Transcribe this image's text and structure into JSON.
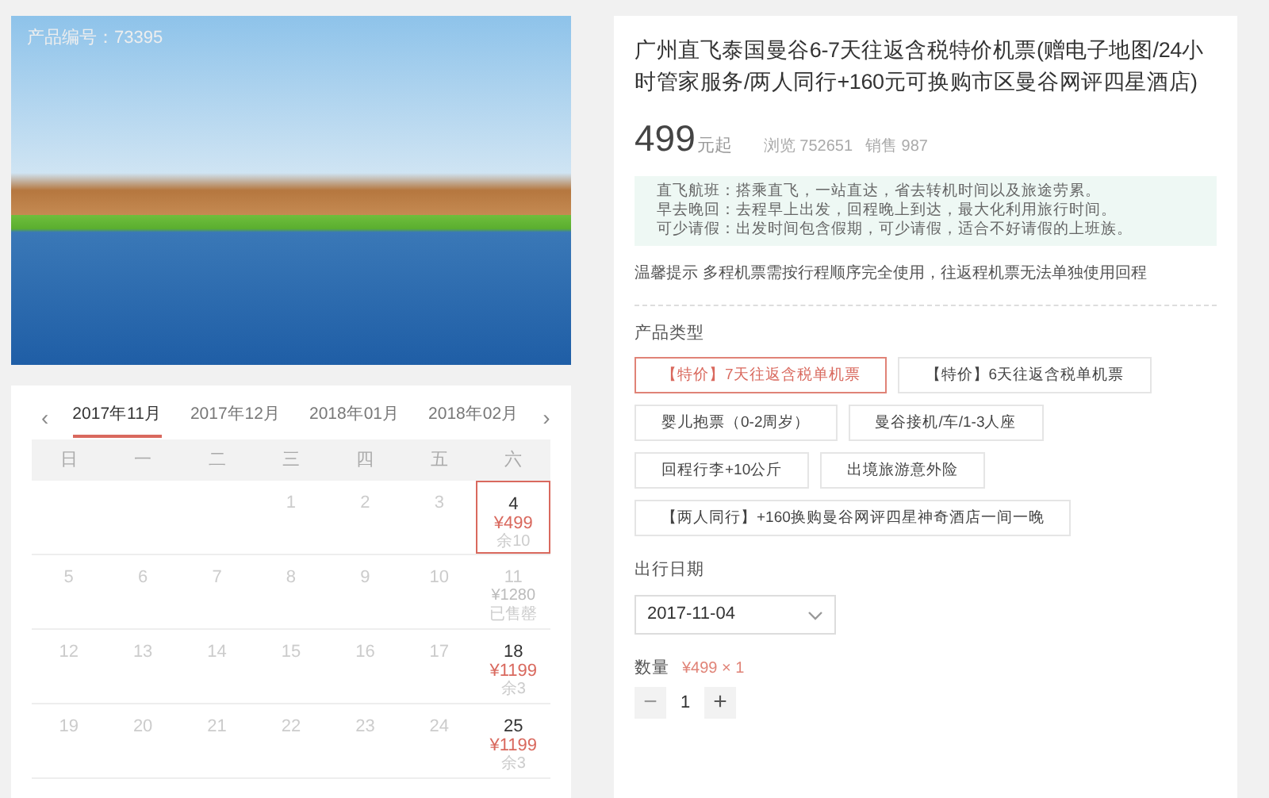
{
  "photo": {
    "caption": "产品编号：73395"
  },
  "calendar": {
    "prev": "‹",
    "next": "›",
    "months": [
      {
        "label": "2017年11月",
        "selected": true
      },
      {
        "label": "2017年12月",
        "selected": false
      },
      {
        "label": "2018年01月",
        "selected": false
      },
      {
        "label": "2018年02月",
        "selected": false
      }
    ],
    "weekdays": [
      "日",
      "一",
      "二",
      "三",
      "四",
      "五",
      "六"
    ],
    "weeks": [
      [
        {
          "kind": "blank"
        },
        {
          "kind": "blank"
        },
        {
          "kind": "blank"
        },
        {
          "kind": "day",
          "day": "1",
          "available": false,
          "selected": false
        },
        {
          "kind": "day",
          "day": "2",
          "available": false,
          "selected": false
        },
        {
          "kind": "day",
          "day": "3",
          "available": false,
          "selected": false
        },
        {
          "kind": "day",
          "day": "4",
          "available": true,
          "selected": true,
          "price": "¥499",
          "stock": "余10"
        }
      ],
      [
        {
          "kind": "day",
          "day": "5",
          "available": false,
          "selected": false
        },
        {
          "kind": "day",
          "day": "6",
          "available": false,
          "selected": false
        },
        {
          "kind": "day",
          "day": "7",
          "available": false,
          "selected": false
        },
        {
          "kind": "day",
          "day": "8",
          "available": false,
          "selected": false
        },
        {
          "kind": "day",
          "day": "9",
          "available": false,
          "selected": false
        },
        {
          "kind": "day",
          "day": "10",
          "available": false,
          "selected": false
        },
        {
          "kind": "day",
          "day": "11",
          "available": false,
          "selected": false,
          "price": "¥1280",
          "stock": "已售罄"
        }
      ],
      [
        {
          "kind": "day",
          "day": "12",
          "available": false,
          "selected": false
        },
        {
          "kind": "day",
          "day": "13",
          "available": false,
          "selected": false
        },
        {
          "kind": "day",
          "day": "14",
          "available": false,
          "selected": false
        },
        {
          "kind": "day",
          "day": "15",
          "available": false,
          "selected": false
        },
        {
          "kind": "day",
          "day": "16",
          "available": false,
          "selected": false
        },
        {
          "kind": "day",
          "day": "17",
          "available": false,
          "selected": false
        },
        {
          "kind": "day",
          "day": "18",
          "available": true,
          "selected": false,
          "price": "¥1199",
          "stock": "余3"
        }
      ],
      [
        {
          "kind": "day",
          "day": "19",
          "available": false,
          "selected": false
        },
        {
          "kind": "day",
          "day": "20",
          "available": false,
          "selected": false
        },
        {
          "kind": "day",
          "day": "21",
          "available": false,
          "selected": false
        },
        {
          "kind": "day",
          "day": "22",
          "available": false,
          "selected": false
        },
        {
          "kind": "day",
          "day": "23",
          "available": false,
          "selected": false
        },
        {
          "kind": "day",
          "day": "24",
          "available": false,
          "selected": false
        },
        {
          "kind": "day",
          "day": "25",
          "available": true,
          "selected": false,
          "price": "¥1199",
          "stock": "余3"
        }
      ]
    ]
  },
  "product": {
    "title": "广州直飞泰国曼谷6-7天往返含税特价机票(赠电子地图/24小时管家服务/两人同行+160元可换购市区曼谷网评四星酒店)",
    "price": "499",
    "price_unit": "元起",
    "views": "浏览 752651",
    "sales": "销售 987",
    "highlights": [
      "直飞航班：搭乘直飞，一站直达，省去转机时间以及旅途劳累。",
      "早去晚回：去程早上出发，回程晚上到达，最大化利用旅行时间。",
      "可少请假：出发时间包含假期，可少请假，适合不好请假的上班族。"
    ],
    "tip": "温馨提示 多程机票需按行程顺序完全使用，往返程机票无法单独使用回程",
    "type_label": "产品类型",
    "types": [
      {
        "label": "【特价】7天往返含税单机票",
        "selected": true
      },
      {
        "label": "【特价】6天往返含税单机票",
        "selected": false
      },
      {
        "label": "婴儿抱票（0-2周岁）",
        "selected": false
      },
      {
        "label": "曼谷接机/车/1-3人座",
        "selected": false
      },
      {
        "label": "回程行李+10公斤",
        "selected": false
      },
      {
        "label": "出境旅游意外险",
        "selected": false
      },
      {
        "label": "【两人同行】+160换购曼谷网评四星神奇酒店一间一晚",
        "selected": false
      }
    ],
    "date_label": "出行日期",
    "date_value": "2017-11-04",
    "qty_label": "数量",
    "qty_summary": "¥499 × 1",
    "qty": {
      "decrement": "−",
      "value": "1",
      "increment": "+",
      "decrement_disabled": true
    }
  }
}
